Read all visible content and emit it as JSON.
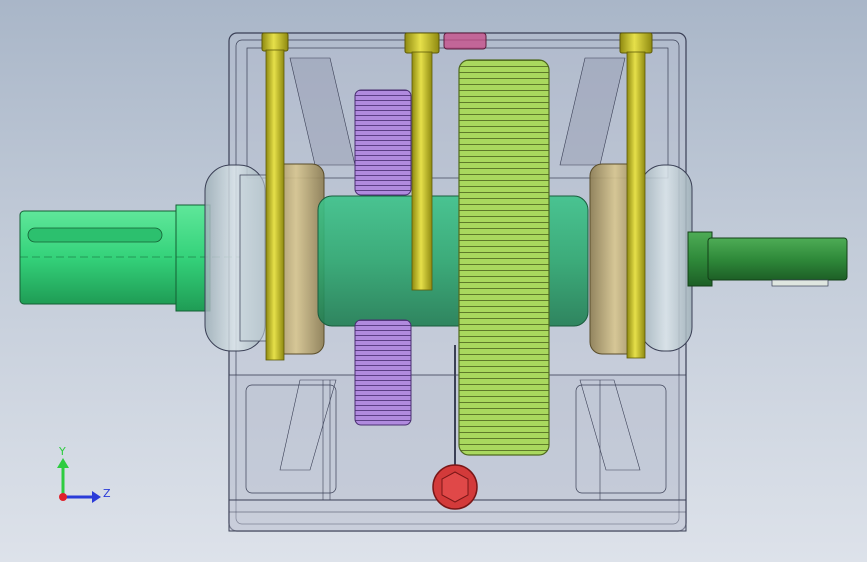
{
  "scene": {
    "subject": "gearbox-assembly-transparent-view",
    "background_top": "#a9b6c8",
    "background_bottom": "#dde2ea"
  },
  "colors": {
    "housing_stroke": "#3a3f55",
    "housing_fill": "#b9bfd0",
    "input_shaft": "#34d27a",
    "output_shaft": "#2f8a3a",
    "bolt": "#c8c21e",
    "large_gear": "#a4d45a",
    "small_gear": "#a07ad0",
    "bearing": "#c9b57a",
    "drain_plug": "#d33a3a",
    "center_shaft": "#2ea870"
  },
  "triad": {
    "y_label": "Y",
    "z_label": "Z",
    "y_color": "#2ecc40",
    "z_color": "#2a3bd8",
    "origin_color": "#e0202a"
  }
}
